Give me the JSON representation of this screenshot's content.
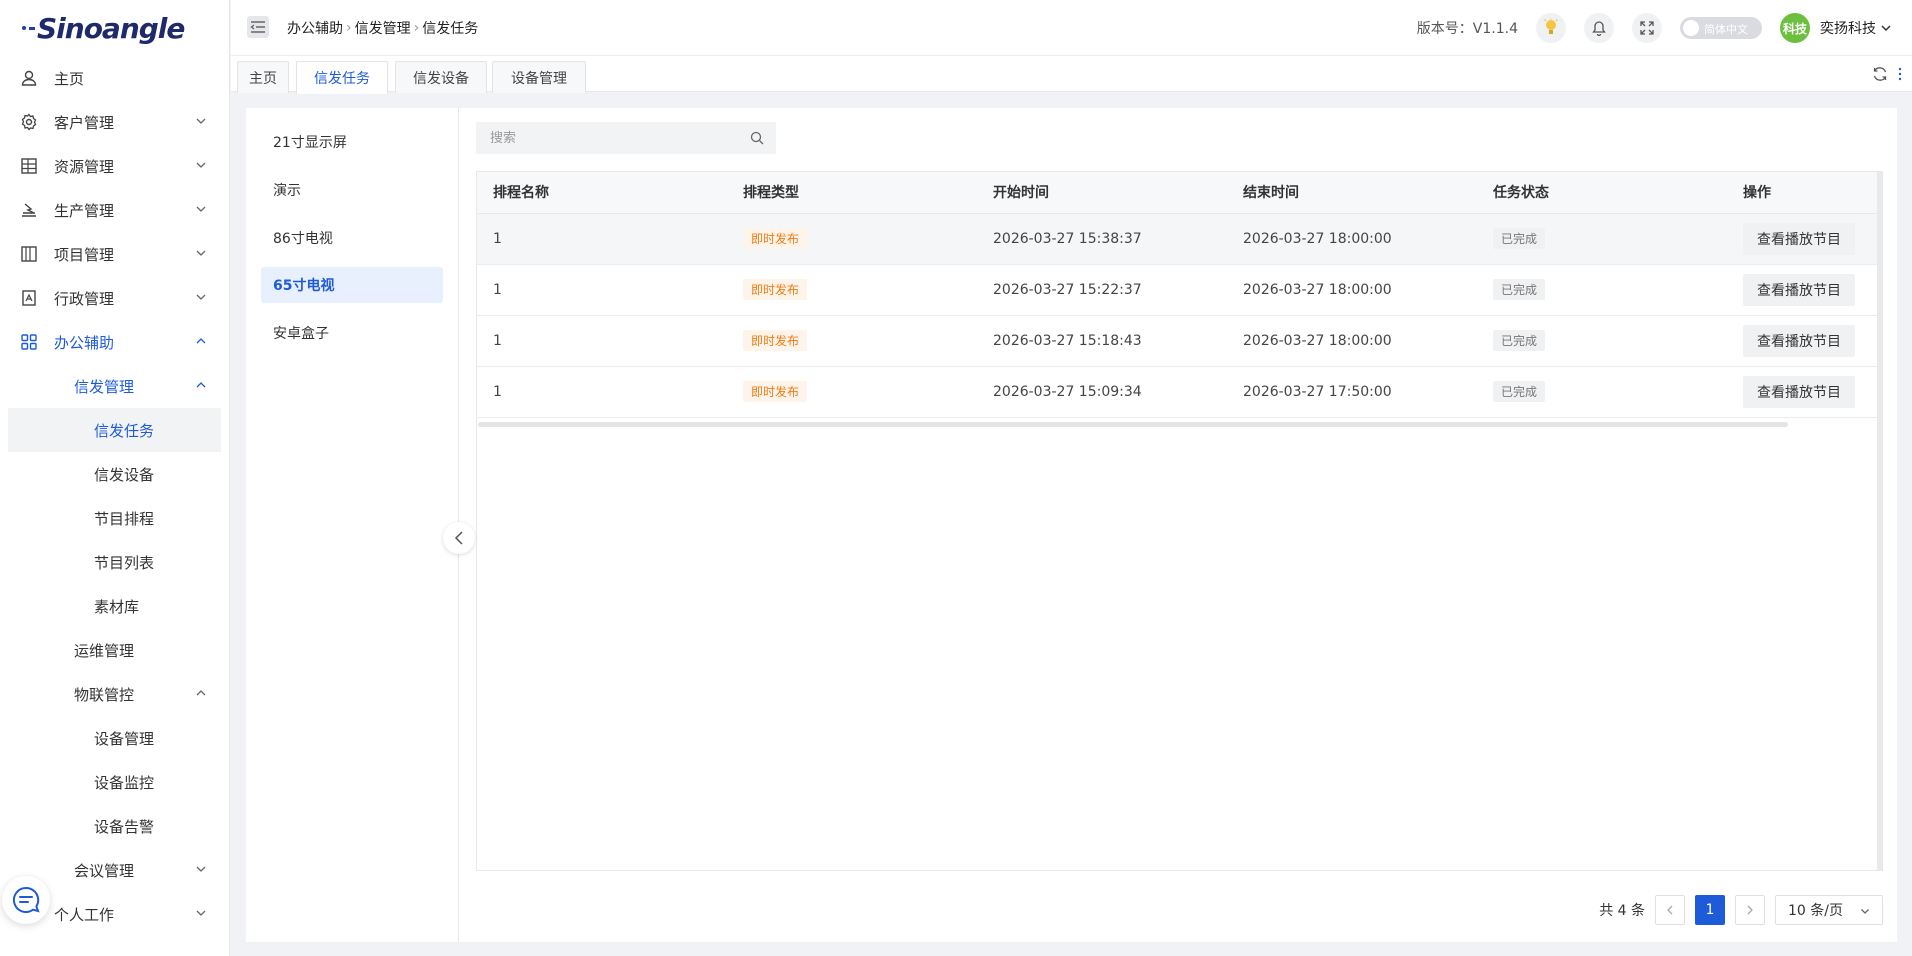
{
  "brand": {
    "logo_text": "Sinoangle"
  },
  "sidebar": {
    "items": [
      {
        "label": "主页",
        "icon": "user-icon"
      },
      {
        "label": "客户管理",
        "icon": "gear-icon"
      },
      {
        "label": "资源管理",
        "icon": "grid-icon"
      },
      {
        "label": "生产管理",
        "icon": "production-icon"
      },
      {
        "label": "项目管理",
        "icon": "book-icon"
      },
      {
        "label": "行政管理",
        "icon": "document-icon"
      },
      {
        "label": "办公辅助",
        "icon": "apps-icon"
      },
      {
        "label": "信发管理"
      },
      {
        "label": "信发任务"
      },
      {
        "label": "信发设备"
      },
      {
        "label": "节目排程"
      },
      {
        "label": "节目列表"
      },
      {
        "label": "素材库"
      },
      {
        "label": "运维管理"
      },
      {
        "label": "物联管控"
      },
      {
        "label": "设备管理"
      },
      {
        "label": "设备监控"
      },
      {
        "label": "设备告警"
      },
      {
        "label": "会议管理"
      },
      {
        "label": "个人工作"
      }
    ]
  },
  "header": {
    "breadcrumb": [
      "办公辅助",
      "信发管理",
      "信发任务"
    ],
    "version": "版本号：V1.1.4",
    "lang_label": "简体中文",
    "avatar_text": "科技",
    "user_name": "奕扬科技"
  },
  "tabs": [
    {
      "label": "主页"
    },
    {
      "label": "信发任务"
    },
    {
      "label": "信发设备"
    },
    {
      "label": "设备管理"
    }
  ],
  "device_list": [
    "21寸显示屏",
    "演示",
    "86寸电视",
    "65寸电视",
    "安卓盒子"
  ],
  "search": {
    "placeholder": "搜索"
  },
  "table": {
    "headers": [
      "排程名称",
      "排程类型",
      "开始时间",
      "结束时间",
      "任务状态",
      "操作"
    ],
    "rows": [
      {
        "name": "1",
        "type": "即时发布",
        "start": "2026-03-27 15:38:37",
        "end": "2026-03-27 18:00:00",
        "status": "已完成",
        "action": "查看播放节目"
      },
      {
        "name": "1",
        "type": "即时发布",
        "start": "2026-03-27 15:22:37",
        "end": "2026-03-27 18:00:00",
        "status": "已完成",
        "action": "查看播放节目"
      },
      {
        "name": "1",
        "type": "即时发布",
        "start": "2026-03-27 15:18:43",
        "end": "2026-03-27 18:00:00",
        "status": "已完成",
        "action": "查看播放节目"
      },
      {
        "name": "1",
        "type": "即时发布",
        "start": "2026-03-27 15:09:34",
        "end": "2026-03-27 17:50:00",
        "status": "已完成",
        "action": "查看播放节目"
      }
    ]
  },
  "pagination": {
    "total": "共 4 条",
    "current_page": "1",
    "page_size": "10 条/页"
  },
  "colors": {
    "accent": "#1e5bd9",
    "tag_orange": "#f07b14",
    "avatar_green": "#6cbf3f"
  }
}
